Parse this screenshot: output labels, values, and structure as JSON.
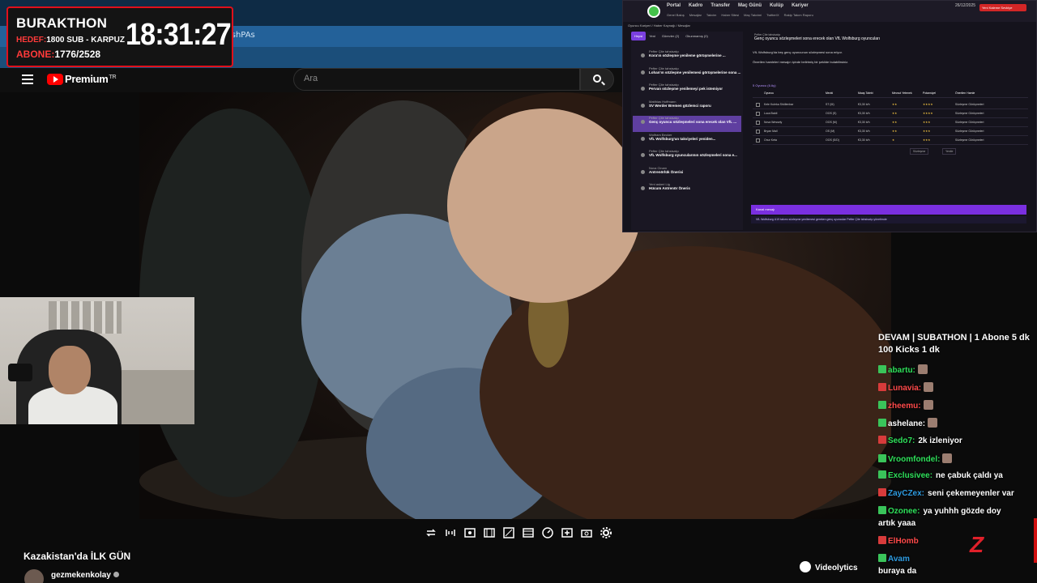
{
  "browser": {
    "url_fragment": "FshPAs"
  },
  "youtube": {
    "brand": "Premium",
    "region": "TR",
    "search_placeholder": "Ara"
  },
  "timer_overlay": {
    "title": "BURAKTHON",
    "goal_label": "HEDEF:",
    "goal_value": "1800 SUB - KARPUZ",
    "subs_label": "ABONE:",
    "subs_value": "1776/2528",
    "clock": "18:31:27"
  },
  "portal_overlay": {
    "nav": [
      "Portal",
      "Kadro",
      "Transfer",
      "Maç Günü",
      "Kulüp",
      "Kariyer"
    ],
    "subnav": [
      "Genel Bakış",
      "Mesajlar",
      "Takvim",
      "Haber Sitesi",
      "Maç Takvimi",
      "Twitter/X",
      "Rakip Takım Raporu"
    ],
    "date": "26/12/2025",
    "red_button": "Yeni Kaleme Sevkiye",
    "breadcrumb": "Oyuncu Kariyeri / Haber Kaynağı / Mesajlar",
    "tabs": [
      "Hepsi",
      "Yeni",
      "Görevler (2)",
      "Okunmamış (0)"
    ],
    "messages": [
      {
        "sender": "Pefter Çite tahsisatçı",
        "subject": "Kora'ın sözleşme yenileme görüşmelerine ..."
      },
      {
        "sender": "Pefter Çite tahsisatçı",
        "subject": "Lohan'ın sözleşme yenilemesi görüşmelerine sona ..."
      },
      {
        "sender": "Pefter Çite tahsisatçı",
        "subject": "Pervan sözleşme yenilemeyi pek istemiyor"
      },
      {
        "sender": "Matthias Hoffmann",
        "subject": "SV Werder Bremen gözlemci raporu"
      },
      {
        "sender": "Pefter Çite tahsisatçı",
        "subject": "Genç oyuncu sözleşmeleri sona erecek olan VfL ..."
      },
      {
        "sender": "Wolfram Becker",
        "subject": "VfL Wolfsburg'un takviyeleri yeniden..."
      },
      {
        "sender": "Pefter Çite tahsisatçı",
        "subject": "VfL Wolfsburg oyuncularının sözleşmeleri sona e..."
      },
      {
        "sender": "Nova Cinam",
        "subject": "Antrenörlük Önerisi"
      },
      {
        "sender": "Yeni askeri Lig",
        "subject": "Hücum Antrenör Öneris"
      }
    ],
    "detail_sender": "Pefter Çite tahsisatçı",
    "detail_subject": "Genç oyuncu sözleşmeleri sona erecek olan VfL Wolfsburg oyuncuları",
    "detail_body_1": "VfL Wolfsburg'da beş genç oyuncunun sözleşmesi sona eriyor.",
    "detail_body_2": "Önerilen hamleleri mesajın içinde belirtmiş bir şekilde bulabilirsiniz.",
    "table_title": "5 Oyuncu (6 Ay)",
    "table_headers": [
      "Oyuncu",
      "Mevki",
      "Maaş Talebi",
      "Mevcut Yetenek",
      "Potansiyel",
      "Önerilen Hamle"
    ],
    "table_rows": [
      [
        "Kele Kuleka Shöllenbar",
        "ST (M)",
        "€3,30 b/h",
        "★★",
        "★★★★",
        "Sözleşme Görüşmeleri"
      ],
      [
        "Luca Baldi",
        "OOS (S)",
        "€3,30 b/h",
        "★★",
        "★★★★",
        "Sözleşme Görüşmeleri"
      ],
      [
        "Nova Wessely",
        "OOS (M)",
        "€3,30 b/h",
        "★★",
        "★★★",
        "Sözleşme Görüşmeleri"
      ],
      [
        "Bryan Mail",
        "OS (M)",
        "€3,30 b/h",
        "★★",
        "★★★",
        "Sözleşme Görüşmeleri"
      ],
      [
        "Onur Keta",
        "OOS (S/D)",
        "€3,30 b/h",
        "★",
        "★★★",
        "Sözleşme Görüşmeleri"
      ]
    ],
    "purple_bar": "Kanal mesajı",
    "bottom_bar": "VfL Wolfsburg U19 takımı sözleşme yenilemesi gereken genç oyuncular Pefter Çite tahsisatçı yönetimde"
  },
  "chat": {
    "header": "DEVAM | SUBATHON | 1 Abone 5 dk 100 Kicks 1 dk",
    "messages": [
      {
        "user": "abartu:",
        "text": "",
        "color": "#2ee05a",
        "emote": true
      },
      {
        "user": "Lunavia:",
        "text": "",
        "color": "#ff4a4a",
        "emote": true
      },
      {
        "user": "zheemu:",
        "text": "",
        "color": "#ff4a4a",
        "emote": true
      },
      {
        "user": "ashelane:",
        "text": "",
        "color": "#ffffff",
        "emote": true
      },
      {
        "user": "Sedo7:",
        "text": "2k izleniyor",
        "color": "#2ee05a",
        "emote": false
      },
      {
        "user": "Vroomfondel:",
        "text": "",
        "color": "#2ee05a",
        "emote": true
      },
      {
        "user": "Exclusivee:",
        "text": "ne çabuk çaldı ya",
        "color": "#2ee05a",
        "emote": false
      },
      {
        "user": "ZayCZex:",
        "text": "seni çekemeyenler var",
        "color": "#2e9be0",
        "emote": false
      },
      {
        "user": "Ozonee:",
        "text": "ya yuhhh gözde doy",
        "color": "#2ee05a",
        "emote": false
      },
      {
        "user": "",
        "text": "artık yaaa",
        "color": "#ffffff",
        "emote": false
      },
      {
        "user": "ElHomb",
        "text": "",
        "color": "#ff4a4a",
        "emote": false
      },
      {
        "user": "Avam",
        "text": "",
        "color": "#2e9be0",
        "emote": false
      },
      {
        "user": "",
        "text": "buraya da",
        "color": "#ffffff",
        "emote": false
      }
    ]
  },
  "video": {
    "title": "Kazakistan'da İLK GÜN",
    "channel": "gezmekenkolay",
    "videolytics": "Videolytics"
  },
  "colors": {
    "accent_red": "#e0101b",
    "purple": "#7a2fe0",
    "chat_green": "#2ee05a"
  }
}
